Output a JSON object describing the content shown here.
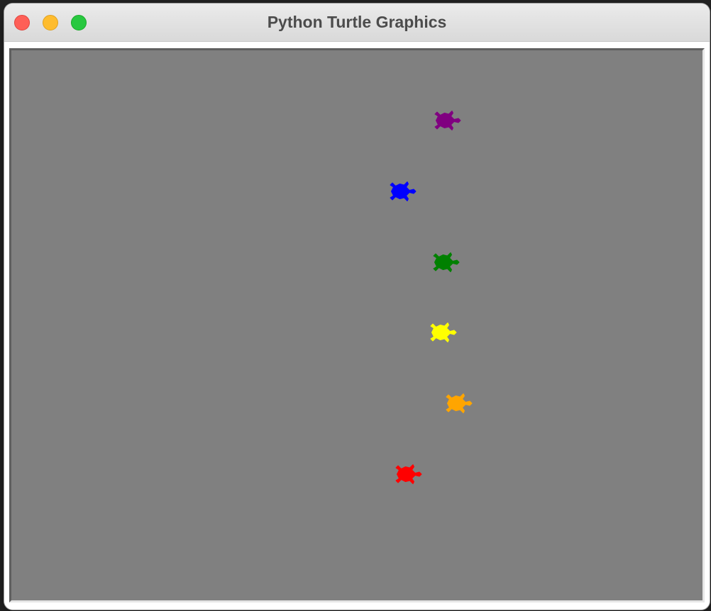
{
  "window": {
    "title": "Python Turtle Graphics"
  },
  "canvas": {
    "background_color": "#808080"
  },
  "turtles": [
    {
      "name": "turtle-purple",
      "color": "#800080",
      "heading": 0
    },
    {
      "name": "turtle-blue",
      "color": "#0000ff",
      "heading": 0
    },
    {
      "name": "turtle-green",
      "color": "#008000",
      "heading": 0
    },
    {
      "name": "turtle-yellow",
      "color": "#ffff00",
      "heading": 0
    },
    {
      "name": "turtle-orange",
      "color": "#ffa500",
      "heading": 0
    },
    {
      "name": "turtle-red",
      "color": "#ff0000",
      "heading": 0
    }
  ]
}
